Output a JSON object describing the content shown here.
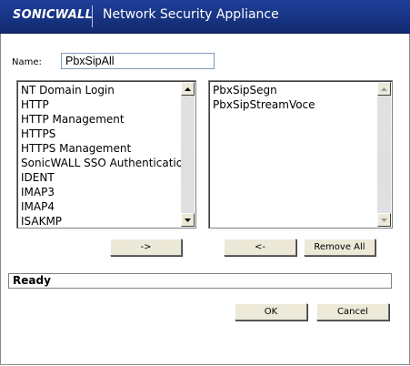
{
  "header": {
    "logo_text": "SONICWALL",
    "title": "Network Security Appliance"
  },
  "name_field": {
    "label": "Name:",
    "value": "PbxSipAll"
  },
  "available_list": {
    "items": [
      "NT Domain Login",
      "HTTP",
      "HTTP Management",
      "HTTPS",
      "HTTPS Management",
      "SonicWALL SSO Authenticatio",
      "IDENT",
      "IMAP3",
      "IMAP4",
      "ISAKMP"
    ]
  },
  "selected_list": {
    "items": [
      "PbxSipSegn",
      "PbxSipStreamVoce"
    ]
  },
  "buttons": {
    "add": "->",
    "remove": "<-",
    "remove_all": "Remove All",
    "ok": "OK",
    "cancel": "Cancel"
  },
  "status": {
    "text": "Ready"
  },
  "colors": {
    "header_blue": "#1a3a8f",
    "button_face": "#ece9d8"
  },
  "icons": {
    "scroll_up": "arrow-up-icon",
    "scroll_down": "arrow-down-icon"
  }
}
